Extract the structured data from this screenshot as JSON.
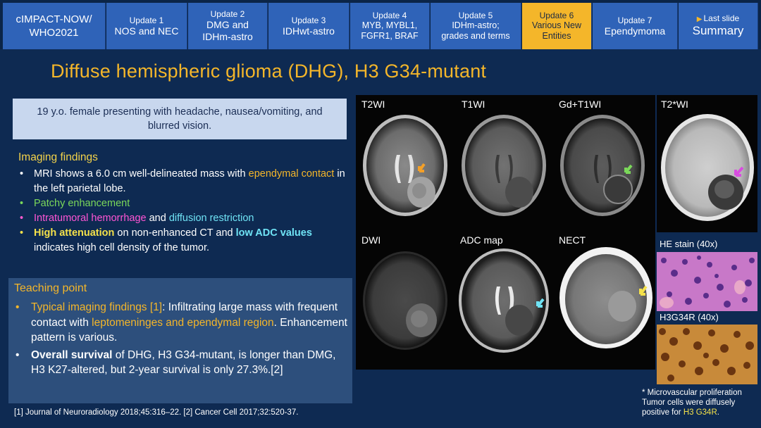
{
  "nav": {
    "first_line1": "cIMPACT-NOW/",
    "first_line2": "WHO2021",
    "tabs": [
      {
        "line1": "Update 1",
        "line2": "NOS and NEC",
        "line3": ""
      },
      {
        "line1": "Update 2",
        "line2": "DMG and",
        "line3": "IDHm-astro"
      },
      {
        "line1": "Update 3",
        "line2": "IDHwt-astro",
        "line3": ""
      },
      {
        "line1": "Update 4",
        "line2": "MYB, MYBL1,",
        "line3": "FGFR1, BRAF"
      },
      {
        "line1": "Update 5",
        "line2": "IDHm-astro;",
        "line3": "grades and terms"
      },
      {
        "line1": "Update 6",
        "line2": "Various New",
        "line3": "Entities"
      },
      {
        "line1": "Update 7",
        "line2": "Ependymoma",
        "line3": ""
      }
    ],
    "last_slide": "Last slide",
    "summary": "Summary"
  },
  "title": "Diffuse hemispheric glioma (DHG), H3 G34-mutant",
  "case": "19 y.o. female presenting with headache, nausea/vomiting, and blurred vision.",
  "findings": {
    "title": "Imaging findings",
    "b1_pre": "MRI shows a 6.0 cm well-delineated mass with ",
    "b1_hl": "ependymal contact",
    "b1_post": " in the left parietal lobe.",
    "b2": "Patchy enhancement",
    "b3_hl1": "Intratumoral hemorrhage",
    "b3_mid": " and ",
    "b3_hl2": "diffusion restriction",
    "b4_hl1": "High attenuation",
    "b4_mid": " on non-enhanced CT and ",
    "b4_hl2": "low ADC values",
    "b4_post": " indicates high cell density of the tumor."
  },
  "teaching": {
    "title": "Teaching point",
    "t1_hl": "Typical imaging findings [1]",
    "t1_mid": ": Infiltrating large mass with frequent contact with ",
    "t1_hl2": "leptomeninges and ependymal region",
    "t1_post": ". Enhancement pattern is various.",
    "t2_b": "Overall survival",
    "t2_post": " of DHG, H3 G34-mutant, is longer than DMG, H3 K27-altered, but 2-year survival is only 27.3%.[2]"
  },
  "reference": "[1] Journal of Neuroradiology 2018;45:316–22. [2] Cancer Cell 2017;32:520-37.",
  "images": {
    "t2wi": "T2WI",
    "t1wi": "T1WI",
    "gd": "Gd+T1WI",
    "t2star": "T2*WI",
    "dwi": "DWI",
    "adc": "ADC map",
    "nect": "NECT",
    "he": "HE stain (40x)",
    "h3g34r": "H3G34R (40x)"
  },
  "note": {
    "line1": "* Microvascular proliferation",
    "line2": "Tumor cells were diffusely",
    "line3_pre": "positive for ",
    "line3_hl": "H3 G34R",
    "line3_post": "."
  },
  "colors": {
    "accent": "#f4b62a",
    "tab": "#2f63b8",
    "background": "#0e2a52",
    "arrow_orange": "#f4a028",
    "arrow_green": "#7bd85a",
    "arrow_magenta": "#d94ce0",
    "arrow_cyan": "#6fe3f5",
    "arrow_yellow": "#f4e14a"
  }
}
